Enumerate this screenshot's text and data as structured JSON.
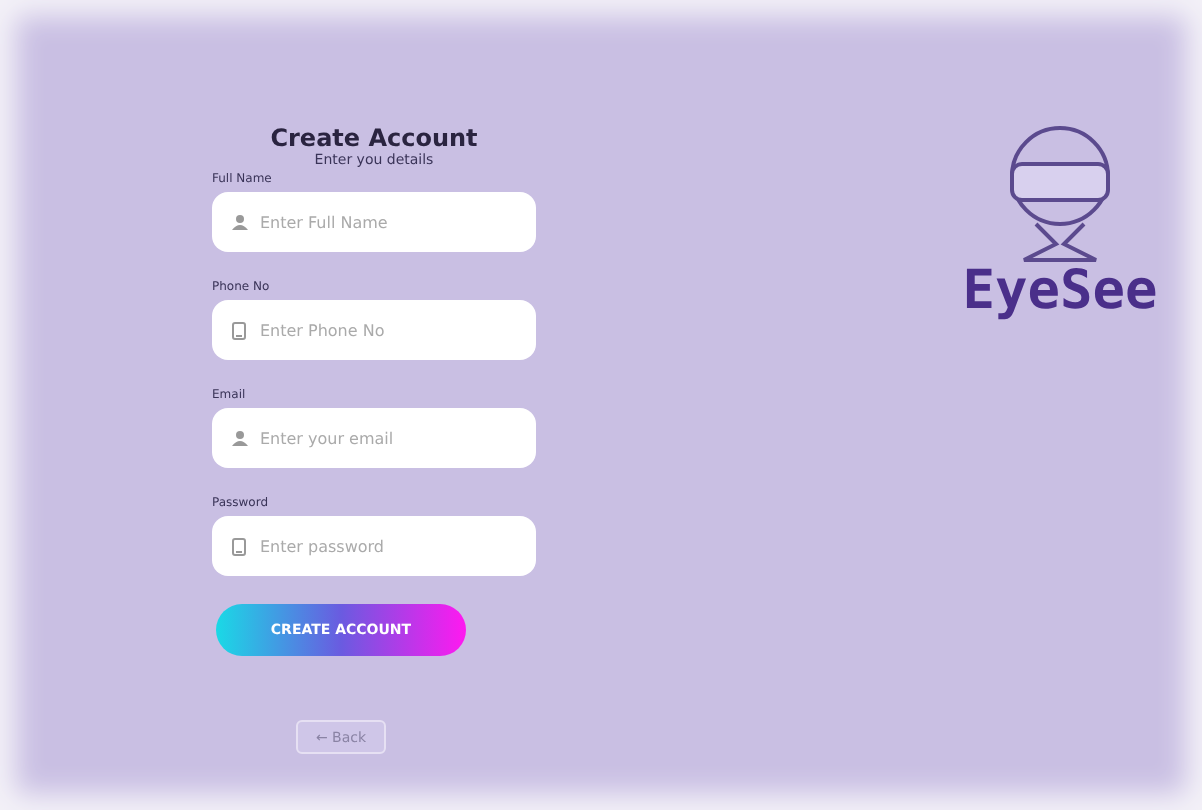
{
  "form": {
    "title": "Create Account",
    "subtitle": "Enter you details",
    "fields": [
      {
        "label": "Full Name",
        "placeholder": "Enter Full Name",
        "kind": "person"
      },
      {
        "label": "Phone No",
        "placeholder": "Enter Phone No",
        "kind": "device"
      },
      {
        "label": "Email",
        "placeholder": "Enter your email",
        "kind": "person"
      },
      {
        "label": "Password",
        "placeholder": "Enter password",
        "kind": "device"
      }
    ],
    "submit": "CREATE ACCOUNT",
    "back": "← Back"
  },
  "logo": {
    "name": "EyeSee"
  }
}
